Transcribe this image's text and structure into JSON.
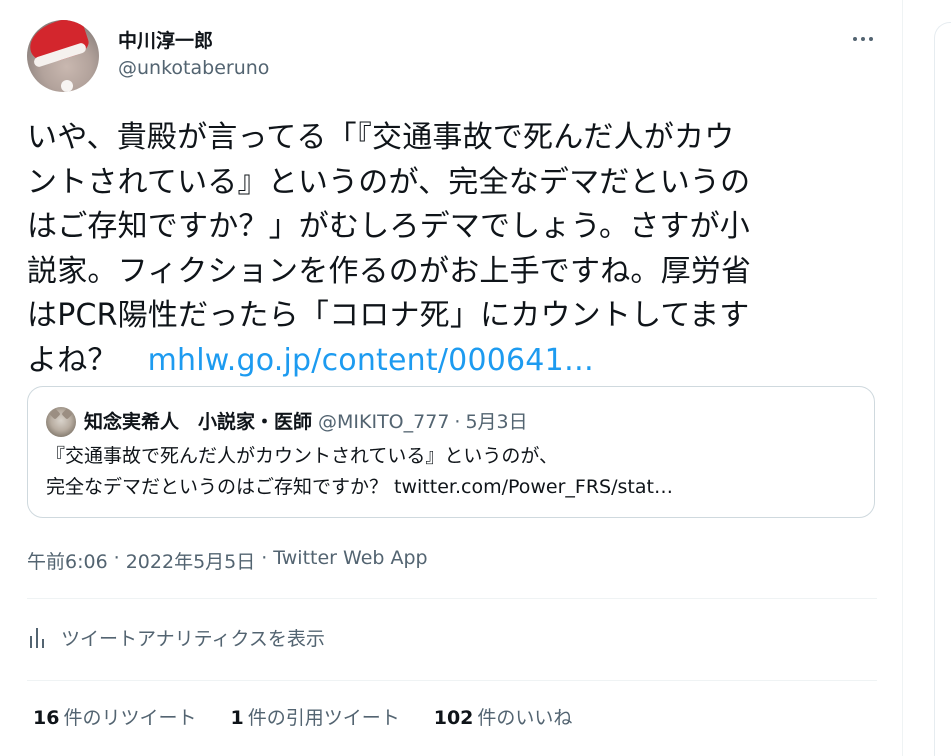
{
  "author": {
    "display_name": "中川淳一郎",
    "handle": "@unkotaberuno"
  },
  "tweet": {
    "text_lines": [
      "いや、貴殿が言ってる「『交通事故で死んだ人がカウ",
      "ントされている』というのが、完全なデマだというの",
      "はご存知ですか？」がむしろデマでしょう。さすが小",
      "説家。フィクションを作るのがお上手ですね。厚労省",
      "はPCR陽性だったら「コロナ死」にカウントしてます",
      "よね？"
    ],
    "link": "mhlw.go.jp/content/000641…"
  },
  "quoted": {
    "name": "知念実希人　小説家・医師",
    "handle": "@MIKITO_777",
    "separator": "·",
    "date": "5月3日",
    "text_lines": [
      "『交通事故で死んだ人がカウントされている』というのが、",
      "完全なデマだというのはご存知ですか？ twitter.com/Power_FRS/stat…"
    ]
  },
  "meta": {
    "time": "午前6:06",
    "date": "2022年5月5日",
    "source": "Twitter Web App",
    "separator": "·"
  },
  "analytics": {
    "label": "ツイートアナリティクスを表示",
    "icon": "bar-chart-icon"
  },
  "stats": {
    "retweets": {
      "count": "16",
      "label": "件のリツイート"
    },
    "quotes": {
      "count": "1",
      "label": "件の引用ツイート"
    },
    "likes": {
      "count": "102",
      "label": "件のいいね"
    }
  },
  "icons": {
    "more": "more-horizontal-icon"
  },
  "colors": {
    "link": "#1d9bf0",
    "secondary_text": "#536471",
    "primary_text": "#0f1419",
    "border": "#cfd9de"
  }
}
